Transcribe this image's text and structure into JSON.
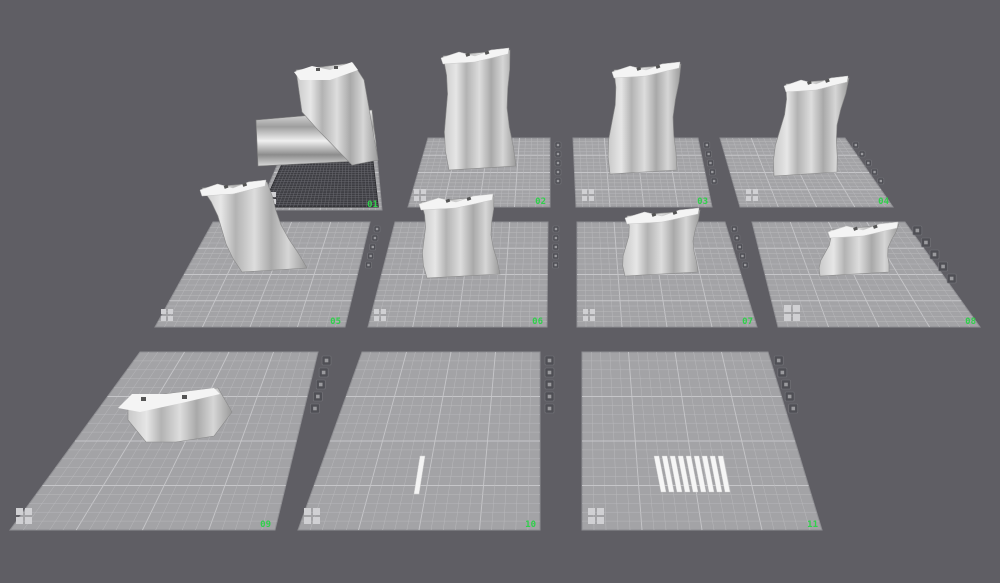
{
  "viewport": {
    "background": "#5f5e64"
  },
  "colors": {
    "plate_fill": "#a3a3a6",
    "plate_line": "#b8b8bb",
    "plate_major": "#c6c6c9",
    "plate_border": "#8e8e92",
    "model_light": "#dcdcdc",
    "model_mid": "#bcbcbc",
    "model_dark": "#8f8f8f",
    "model_top": "#f4f4f4",
    "plate_number": "#2fd04a",
    "plate_label": "#39c25c",
    "icon_fill": "#d0d0d3"
  },
  "plates": [
    {
      "number": "01",
      "label": "",
      "selected": true
    },
    {
      "number": "02",
      "label": ""
    },
    {
      "number": "03",
      "label": ""
    },
    {
      "number": "04",
      "label": ""
    },
    {
      "number": "05",
      "label": ""
    },
    {
      "number": "06",
      "label": ""
    },
    {
      "number": "07",
      "label": ""
    },
    {
      "number": "08",
      "label": ""
    },
    {
      "number": "09",
      "label": ""
    },
    {
      "number": "10",
      "label": ""
    },
    {
      "number": "11",
      "label": ""
    }
  ],
  "plate_toolbar_icons": [
    "close-icon",
    "lock-icon",
    "settings-icon",
    "orient-icon",
    "arrange-icon"
  ],
  "plate_corner_icon": "grid-four-icon"
}
